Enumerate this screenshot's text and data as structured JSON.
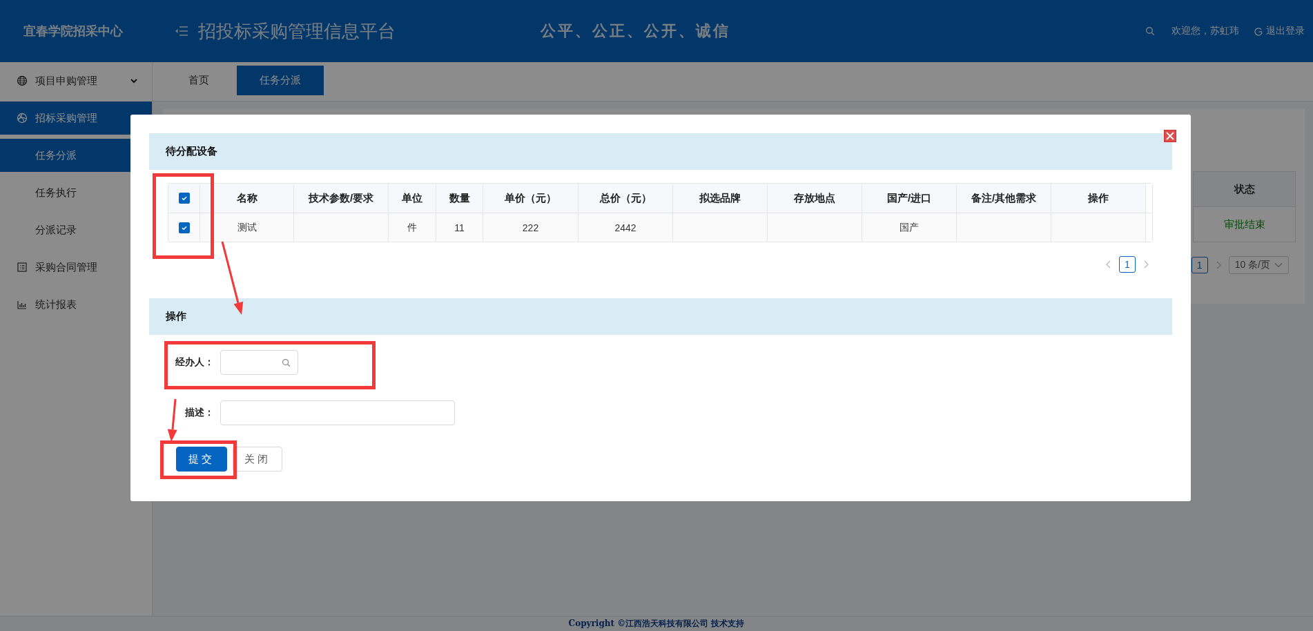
{
  "header": {
    "org_name": "宜春学院招采中心",
    "platform_title": "招投标采购管理信息平台",
    "slogan": "公平、公正、公开、诚信",
    "greeting": "欢迎您，苏虹玮",
    "logout": "退出登录"
  },
  "sidebar": {
    "items": [
      {
        "label": "项目申购管理",
        "kind": "submenu",
        "selected": false
      },
      {
        "label": "招标采购管理",
        "kind": "group",
        "selected": true,
        "children": [
          {
            "label": "任务分派",
            "selected": true
          },
          {
            "label": "任务执行",
            "selected": false
          },
          {
            "label": "分派记录",
            "selected": false
          }
        ]
      },
      {
        "label": "采购合同管理",
        "kind": "link",
        "selected": false
      },
      {
        "label": "统计报表",
        "kind": "link",
        "selected": false
      }
    ]
  },
  "tabs": [
    {
      "label": "首页",
      "selected": false
    },
    {
      "label": "任务分派",
      "selected": true
    }
  ],
  "background_table": {
    "columns": [
      "状态"
    ],
    "rows": [
      [
        "审批结束"
      ]
    ]
  },
  "background_pagination": {
    "page": "1",
    "page_size": "10 条/页"
  },
  "modal": {
    "equipment_section": "待分配设备",
    "table": {
      "select_all": true,
      "columns": [
        "名称",
        "技术参数/要求",
        "单位",
        "数量",
        "单价（元）",
        "总价（元）",
        "拟选品牌",
        "存放地点",
        "国产/进口",
        "备注/其他需求",
        "操作"
      ],
      "rows": [
        {
          "selected": true,
          "cells": [
            "测试",
            null,
            "件",
            "11",
            "222",
            "2442",
            null,
            null,
            "国产",
            null,
            null
          ]
        }
      ]
    },
    "pagination": {
      "page": "1"
    },
    "action_section": "操作",
    "form": {
      "handler_label": "经办人：",
      "description_label": "描述："
    },
    "buttons": [
      {
        "label": "提交",
        "kind": "primary"
      },
      {
        "label": "关闭",
        "kind": "default"
      }
    ]
  },
  "footer": "Copyright ©江西浩天科技有限公司 技术支持"
}
